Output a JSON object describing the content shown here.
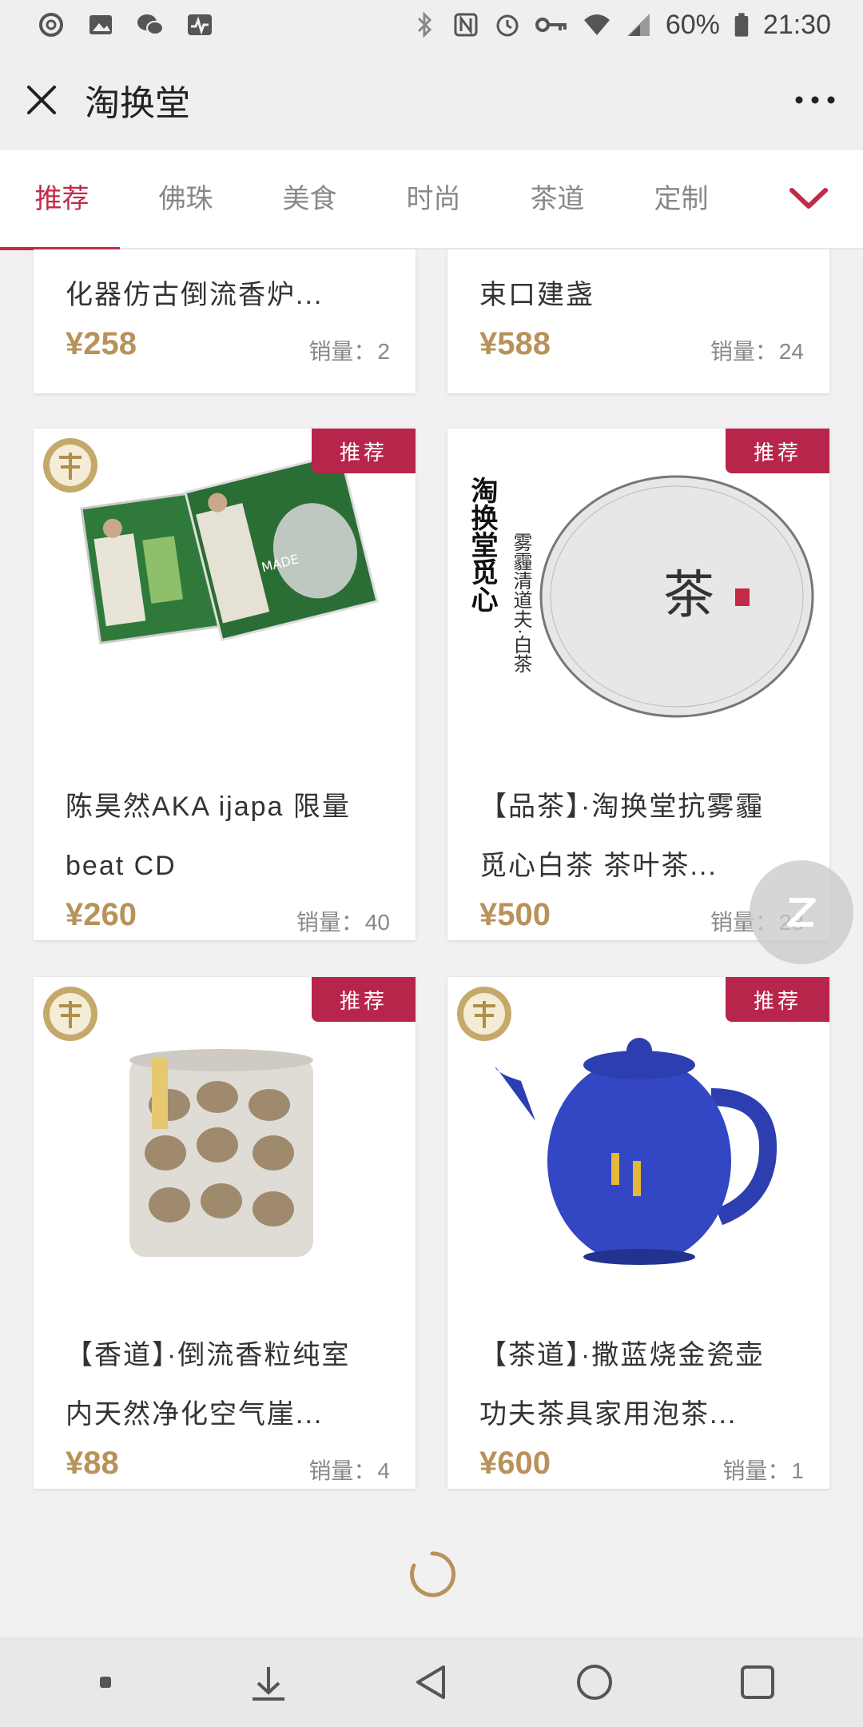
{
  "status_bar": {
    "battery": "60%",
    "time": "21:30",
    "icons": [
      "netease-icon",
      "gallery-icon",
      "wechat-icon",
      "activity-icon",
      "bluetooth-icon",
      "nfc-icon",
      "alarm-icon",
      "vpn-key-icon",
      "wifi-icon",
      "signal-icon",
      "battery-icon"
    ]
  },
  "header": {
    "title": "淘换堂"
  },
  "tabs": [
    {
      "label": "推荐",
      "active": true
    },
    {
      "label": "佛珠"
    },
    {
      "label": "美食"
    },
    {
      "label": "时尚"
    },
    {
      "label": "茶道"
    },
    {
      "label": "定制"
    }
  ],
  "products": [
    {
      "name": "化器仿古倒流香炉...",
      "price": "¥258",
      "sales_label": "销量：",
      "sales": "2"
    },
    {
      "name": "束口建盏",
      "price": "¥588",
      "sales_label": "销量：",
      "sales": "24"
    },
    {
      "badge": "推荐",
      "name_line1": "陈昊然AKA ijapa 限量",
      "name_line2": "beat CD",
      "price": "¥260",
      "sales_label": "销量：",
      "sales": "40"
    },
    {
      "badge": "推荐",
      "name_line1": "【品茶】·淘换堂抗雾霾",
      "name_line2": "觅心白茶 茶叶茶...",
      "price": "¥500",
      "sales_label": "销量：",
      "sales": "28",
      "image_text": {
        "left": "淘换堂觅心",
        "right": "雾霾清道夫·白茶"
      }
    },
    {
      "badge": "推荐",
      "name_line1": "【香道】·倒流香粒纯室",
      "name_line2": "内天然净化空气崖...",
      "price": "¥88",
      "sales_label": "销量：",
      "sales": "4"
    },
    {
      "badge": "推荐",
      "name_line1": "【茶道】·撒蓝烧金瓷壶",
      "name_line2": "功夫茶具家用泡茶...",
      "price": "¥600",
      "sales_label": "销量：",
      "sales": "1"
    }
  ],
  "colors": {
    "accent": "#c22a4a",
    "badge": "#b8254a",
    "price": "#b8925a"
  }
}
